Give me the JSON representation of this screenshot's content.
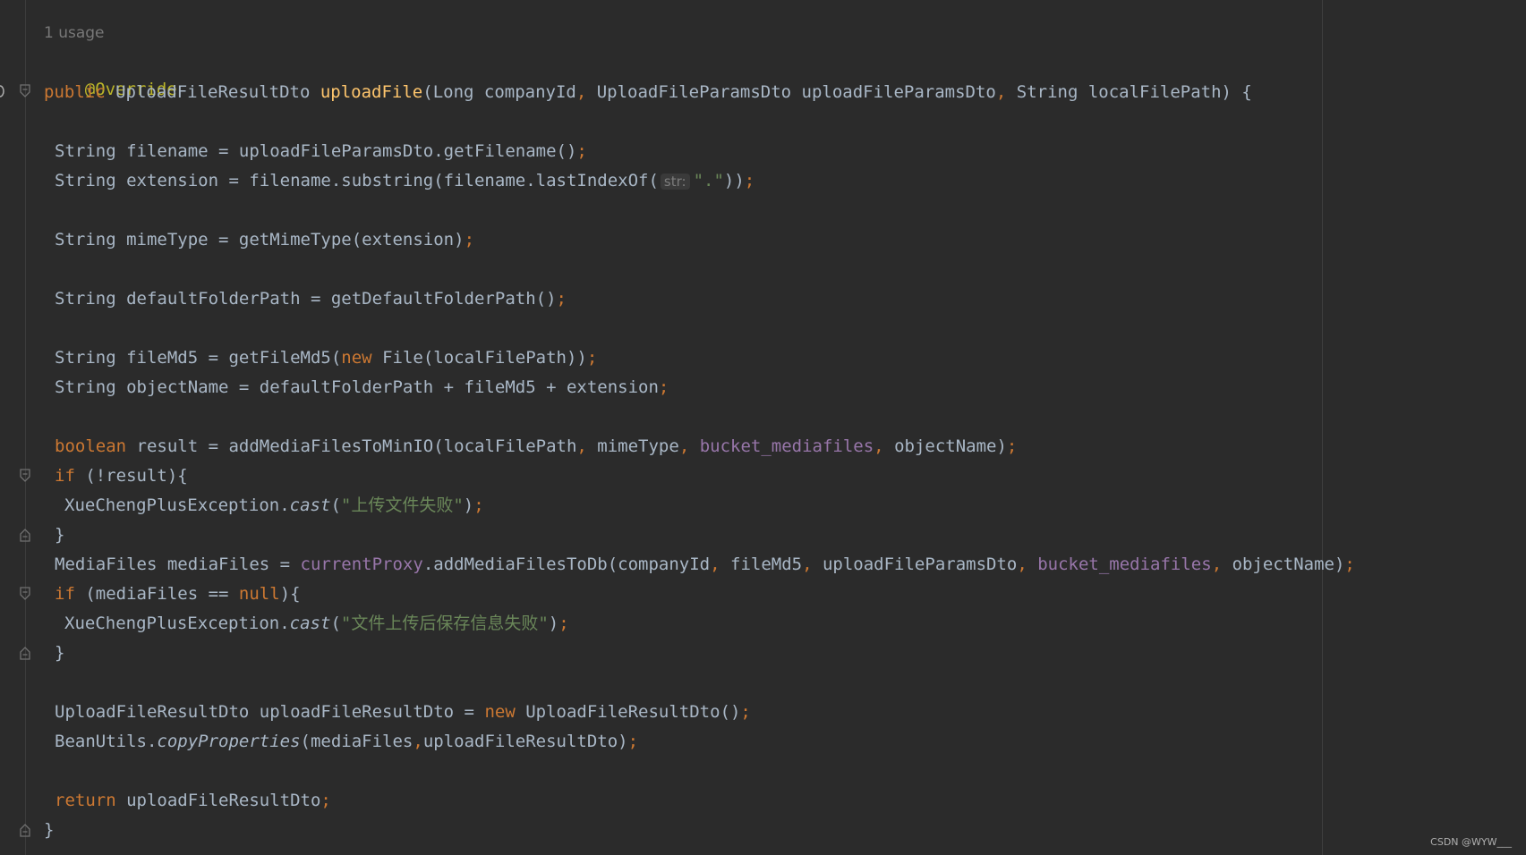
{
  "editor": {
    "usage_hint": "1 usage",
    "lines": [
      {
        "text": "@Override"
      },
      {
        "t1": "public ",
        "t2": "UploadFileResultDto ",
        "t3": "uploadFile",
        "t4": "(Long companyId",
        "t5": ", ",
        "t6": "UploadFileParamsDto uploadFileParamsDto",
        "t7": ", ",
        "t8": "String localFilePath) {"
      },
      {
        "t1": "String filename = uploadFileParamsDto.getFilename()",
        "t2": ";"
      },
      {
        "t1": "String extension = filename.substring(filename.lastIndexOf(",
        "hint": "str:",
        "t2": "\".\"",
        "t3": "))",
        "t4": ";"
      },
      {
        "t1": "String mimeType = getMimeType(extension)",
        "t2": ";"
      },
      {
        "t1": "String defaultFolderPath = getDefaultFolderPath()",
        "t2": ";"
      },
      {
        "t1": "String fileMd5 = getFileMd5(",
        "t2": "new ",
        "t3": "File(localFilePath))",
        "t4": ";"
      },
      {
        "t1": "String objectName = defaultFolderPath + fileMd5 + extension",
        "t2": ";"
      },
      {
        "t1": "boolean ",
        "t2": "result = addMediaFilesToMinIO(localFilePath",
        "t3": ", ",
        "t4": "mimeType",
        "t5": ", ",
        "t6": "bucket_mediafiles",
        "t7": ", ",
        "t8": "objectName)",
        "t9": ";"
      },
      {
        "t1": "if ",
        "t2": "(!result){"
      },
      {
        "t1": "XueChengPlusException.",
        "t2": "cast",
        "t3": "(",
        "t4": "\"上传文件失败\"",
        "t5": ")",
        "t6": ";"
      },
      {
        "t1": "}"
      },
      {
        "t1": "MediaFiles mediaFiles = ",
        "t2": "currentProxy",
        "t3": ".addMediaFilesToDb(companyId",
        "t4": ", ",
        "t5": "fileMd5",
        "t6": ", ",
        "t7": "uploadFileParamsDto",
        "t8": ", ",
        "t9": "bucket_mediafiles",
        "t10": ", ",
        "t11": "objectName)",
        "t12": ";"
      },
      {
        "t1": "if ",
        "t2": "(mediaFiles == ",
        "t3": "null",
        "t4": "){"
      },
      {
        "t1": "XueChengPlusException.",
        "t2": "cast",
        "t3": "(",
        "t4": "\"文件上传后保存信息失败\"",
        "t5": ")",
        "t6": ";"
      },
      {
        "t1": "}"
      },
      {
        "t1": "UploadFileResultDto uploadFileResultDto = ",
        "t2": "new ",
        "t3": "UploadFileResultDto()",
        "t4": ";"
      },
      {
        "t1": "BeanUtils.",
        "t2": "copyProperties",
        "t3": "(mediaFiles",
        "t4": ",",
        "t5": "uploadFileResultDto)",
        "t6": ";"
      },
      {
        "t1": "return ",
        "t2": "uploadFileResultDto",
        "t3": ";"
      },
      {
        "t1": "}"
      }
    ]
  },
  "watermark": "CSDN @WYW___",
  "colors": {
    "background": "#2b2b2b",
    "keyword": "#cc7832",
    "annotation": "#bbb529",
    "function": "#ffc66d",
    "field": "#9876aa",
    "string": "#6a8759",
    "text": "#a9b7c6"
  }
}
